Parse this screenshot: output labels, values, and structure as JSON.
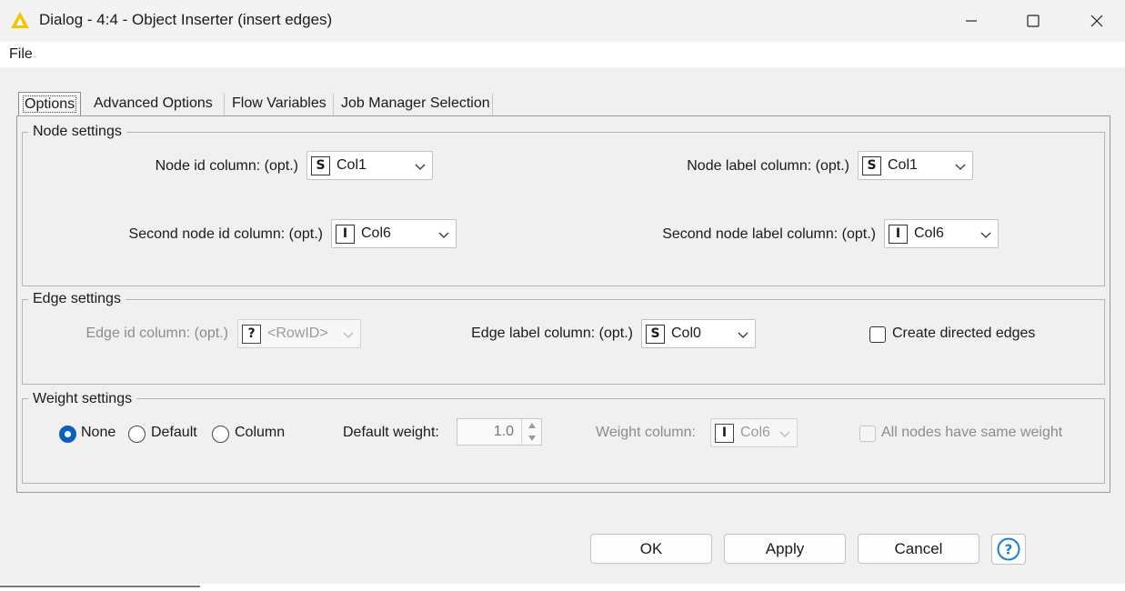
{
  "window": {
    "title": "Dialog - 4:4 - Object Inserter (insert edges)",
    "icon": "knime-triangle-icon",
    "accent_color": "#f5c400"
  },
  "menu": {
    "file": "File"
  },
  "tabs": [
    {
      "label": "Options",
      "selected": true
    },
    {
      "label": "Advanced Options",
      "selected": false
    },
    {
      "label": "Flow Variables",
      "selected": false
    },
    {
      "label": "Job Manager Selection",
      "selected": false
    }
  ],
  "node_settings": {
    "legend": "Node settings",
    "node_id": {
      "label": "Node id column: (opt.)",
      "type": "S",
      "value": "Col1"
    },
    "node_label": {
      "label": "Node label column: (opt.)",
      "type": "S",
      "value": "Col1"
    },
    "second_node_id": {
      "label": "Second node id column: (opt.)",
      "type": "I",
      "value": "Col6"
    },
    "second_node_label": {
      "label": "Second node label column: (opt.)",
      "type": "I",
      "value": "Col6"
    }
  },
  "edge_settings": {
    "legend": "Edge settings",
    "edge_id": {
      "label": "Edge id column:  (opt.)",
      "type": "?",
      "value": "<RowID>",
      "enabled": false
    },
    "edge_label": {
      "label": "Edge label column: (opt.)",
      "type": "S",
      "value": "Col0"
    },
    "directed": {
      "label": "Create directed edges",
      "checked": false
    }
  },
  "weight_settings": {
    "legend": "Weight settings",
    "radios": [
      {
        "label": "None",
        "selected": true
      },
      {
        "label": "Default",
        "selected": false
      },
      {
        "label": "Column",
        "selected": false
      }
    ],
    "default_weight": {
      "label": "Default weight:",
      "value": "1.0"
    },
    "weight_column": {
      "label": "Weight column:",
      "type": "I",
      "value": "Col6",
      "enabled": false
    },
    "same_weight": {
      "label": "All nodes have same weight",
      "checked": false,
      "enabled": false
    }
  },
  "buttons": {
    "ok": "OK",
    "apply": "Apply",
    "cancel": "Cancel"
  },
  "help_color": "#1a7fd4"
}
